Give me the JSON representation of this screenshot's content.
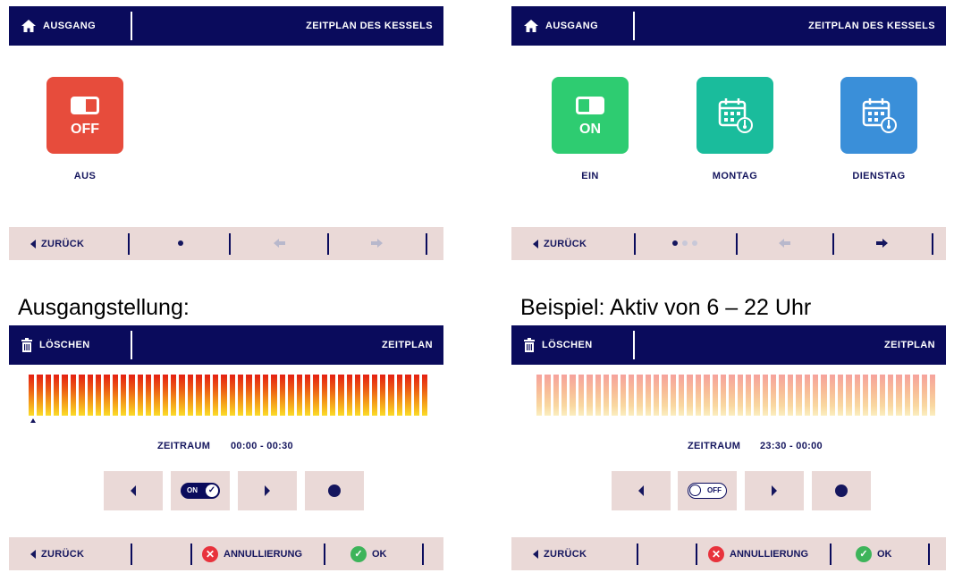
{
  "screens": {
    "boiler_off": {
      "header": {
        "left_label": "AUSGANG",
        "right_label": "ZEITPLAN DES KESSELS"
      },
      "tiles": [
        {
          "icon": "toggle-off-icon",
          "icon_text": "OFF",
          "label": "AUS",
          "color": "#e74c3c"
        }
      ],
      "footer": {
        "back_label": "ZURÜCK"
      }
    },
    "boiler_on": {
      "header": {
        "left_label": "AUSGANG",
        "right_label": "ZEITPLAN DES KESSELS"
      },
      "tiles": [
        {
          "icon": "toggle-on-icon",
          "icon_text": "ON",
          "label": "EIN",
          "color": "#2ecc71"
        },
        {
          "icon": "calendar-icon",
          "label": "MONTAG",
          "color": "#1abc9c"
        },
        {
          "icon": "calendar-icon",
          "label": "DIENSTAG",
          "color": "#3a8fd9"
        }
      ],
      "footer": {
        "back_label": "ZURÜCK"
      }
    },
    "schedule_initial": {
      "caption": "Ausgangstellung:",
      "header": {
        "left_label": "LÖSCHEN",
        "right_label": "ZEITPLAN"
      },
      "bar_count": 48,
      "bars_active": "all",
      "period_label": "ZEITRAUM",
      "period_value": "00:00 - 00:30",
      "toggle_text": "ON",
      "footer": {
        "back_label": "ZURÜCK",
        "cancel_label": "ANNULLIERUNG",
        "ok_label": "OK"
      }
    },
    "schedule_example": {
      "caption": "Beispiel: Aktiv von 6 – 22 Uhr",
      "header": {
        "left_label": "LÖSCHEN",
        "right_label": "ZEITPLAN"
      },
      "bar_count": 48,
      "bars_active": "none",
      "period_label": "ZEITRAUM",
      "period_value": "23:30 - 00:00",
      "toggle_text": "OFF",
      "footer": {
        "back_label": "ZURÜCK",
        "cancel_label": "ANNULLIERUNG",
        "ok_label": "OK"
      }
    }
  },
  "colors": {
    "navy": "#0a0b5c",
    "footer_bg": "#ead9d7",
    "cancel_red": "#e8323c",
    "ok_green": "#3db45a"
  }
}
